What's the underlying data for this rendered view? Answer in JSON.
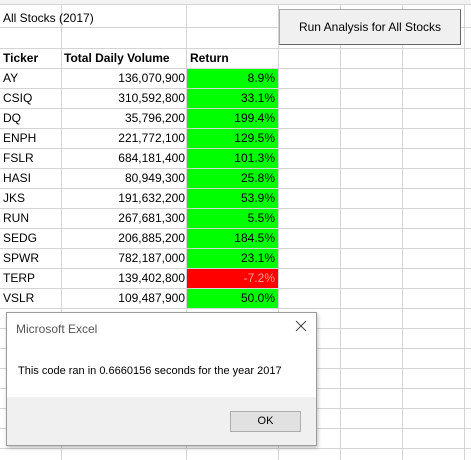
{
  "sheet": {
    "title": "All Stocks (2017)",
    "headers": {
      "ticker": "Ticker",
      "volume": "Total Daily Volume",
      "return": "Return"
    },
    "rows": [
      {
        "ticker": "AY",
        "volume": "136,070,900",
        "return": "8.9%",
        "positive": true
      },
      {
        "ticker": "CSIQ",
        "volume": "310,592,800",
        "return": "33.1%",
        "positive": true
      },
      {
        "ticker": "DQ",
        "volume": "35,796,200",
        "return": "199.4%",
        "positive": true
      },
      {
        "ticker": "ENPH",
        "volume": "221,772,100",
        "return": "129.5%",
        "positive": true
      },
      {
        "ticker": "FSLR",
        "volume": "684,181,400",
        "return": "101.3%",
        "positive": true
      },
      {
        "ticker": "HASI",
        "volume": "80,949,300",
        "return": "25.8%",
        "positive": true
      },
      {
        "ticker": "JKS",
        "volume": "191,632,200",
        "return": "53.9%",
        "positive": true
      },
      {
        "ticker": "RUN",
        "volume": "267,681,300",
        "return": "5.5%",
        "positive": true
      },
      {
        "ticker": "SEDG",
        "volume": "206,885,200",
        "return": "184.5%",
        "positive": true
      },
      {
        "ticker": "SPWR",
        "volume": "782,187,000",
        "return": "23.1%",
        "positive": true
      },
      {
        "ticker": "TERP",
        "volume": "139,402,800",
        "return": "-7.2%",
        "positive": false
      },
      {
        "ticker": "VSLR",
        "volume": "109,487,900",
        "return": "50.0%",
        "positive": true
      }
    ]
  },
  "button": {
    "label": "Run Analysis for All Stocks"
  },
  "dialog": {
    "title": "Microsoft Excel",
    "message": "This code ran in 0.6660156 seconds for the year 2017",
    "ok_label": "OK",
    "close_icon": "close-icon"
  },
  "colors": {
    "positive": "#00ff00",
    "negative": "#ff0000",
    "negative_text": "#ff9d9d",
    "gridline": "#d4d4d4"
  }
}
